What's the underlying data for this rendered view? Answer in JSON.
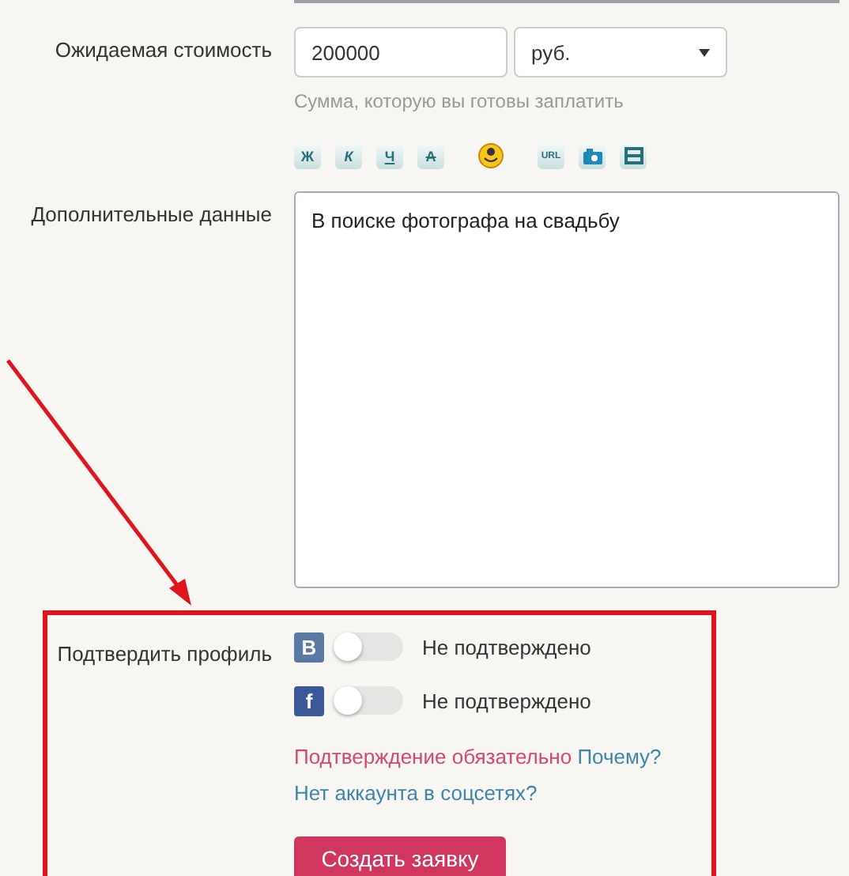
{
  "price": {
    "label": "Ожидаемая стоимость",
    "value": "200000",
    "currency": "руб.",
    "hint": "Сумма, которую вы готовы заплатить"
  },
  "toolbar": [
    {
      "kind": "bold",
      "label": "Ж"
    },
    {
      "kind": "italic",
      "label": "К"
    },
    {
      "kind": "underline",
      "label": "Ч"
    },
    {
      "kind": "strike",
      "label": "А"
    },
    {
      "kind": "smiley"
    },
    {
      "kind": "url",
      "label": "URL"
    },
    {
      "kind": "photo"
    },
    {
      "kind": "video"
    }
  ],
  "details": {
    "label": "Дополнительные данные",
    "value": "В поиске фотографа на свадьбу"
  },
  "verify": {
    "label": "Подтвердить профиль",
    "accounts": [
      {
        "letter": "B",
        "on": false,
        "status": "Не подтверждено"
      },
      {
        "letter": "f",
        "on": false,
        "status": "Не подтверждено"
      }
    ],
    "required": "Подтверждение обязательно",
    "why": "Почему?",
    "no_account": "Нет аккаунта в соцсетях?"
  },
  "submit": "Создать заявку"
}
